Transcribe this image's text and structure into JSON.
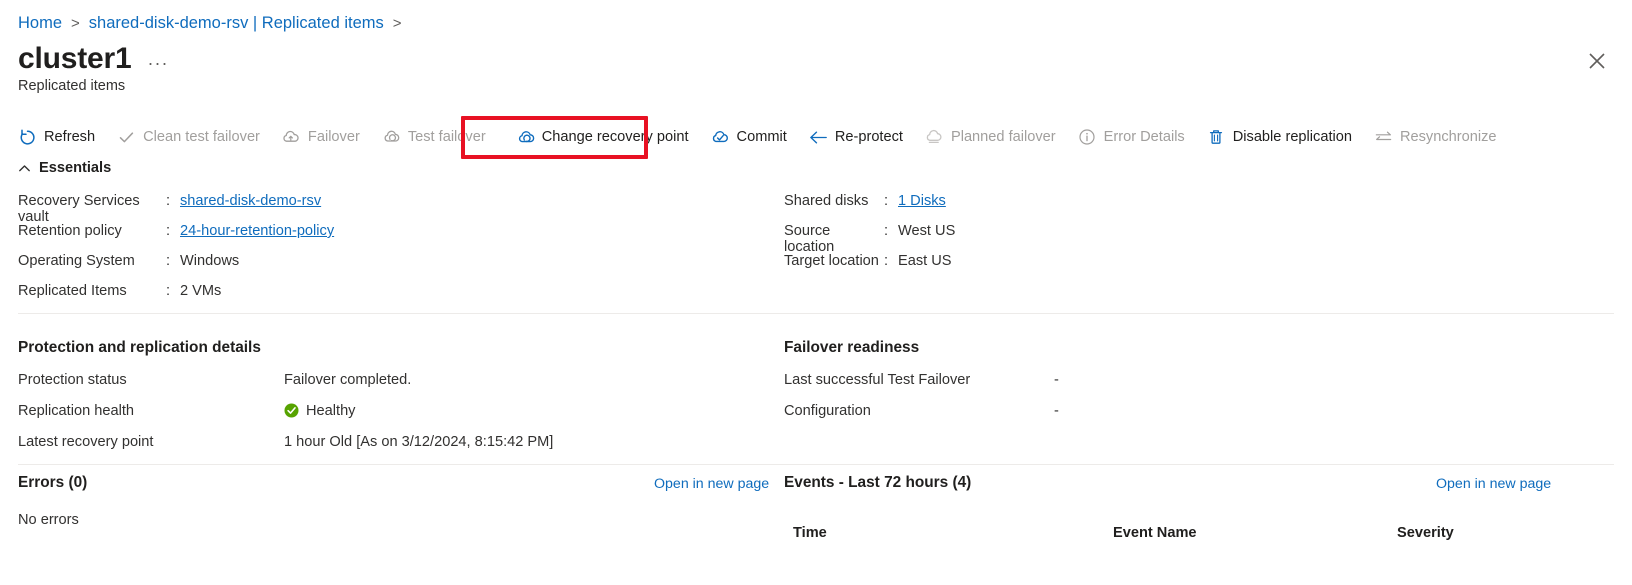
{
  "breadcrumb": {
    "items": [
      {
        "label": "Home",
        "link": true
      },
      {
        "label": "shared-disk-demo-rsv | Replicated items",
        "link": true
      }
    ],
    "separator": ">"
  },
  "header": {
    "title": "cluster1",
    "ellipsis": "···",
    "subtitle": "Replicated items",
    "close_icon": "close-icon"
  },
  "highlight": {
    "color": "#e81123",
    "target": "Change recovery point"
  },
  "commandbar": {
    "items": [
      {
        "label": "Refresh",
        "icon": "refresh-icon",
        "disabled": false,
        "highlighted": false
      },
      {
        "label": "Clean test failover",
        "icon": "checkmark-icon",
        "disabled": true,
        "highlighted": false
      },
      {
        "label": "Failover",
        "icon": "cloud-failover-icon",
        "disabled": true,
        "highlighted": false
      },
      {
        "label": "Test failover",
        "icon": "cloud-test-icon",
        "disabled": true,
        "highlighted": false
      },
      {
        "label": "Change recovery point",
        "icon": "cloud-recovery-icon",
        "disabled": false,
        "highlighted": true
      },
      {
        "label": "Commit",
        "icon": "cloud-check-icon",
        "disabled": false,
        "highlighted": false
      },
      {
        "label": "Re-protect",
        "icon": "arrow-left-icon",
        "disabled": false,
        "highlighted": false
      },
      {
        "label": "Planned failover",
        "icon": "cloud-planned-icon",
        "disabled": true,
        "highlighted": false
      },
      {
        "label": "Error Details",
        "icon": "info-circle-icon",
        "disabled": true,
        "highlighted": false
      },
      {
        "label": "Disable replication",
        "icon": "trash-icon",
        "disabled": false,
        "highlighted": false
      },
      {
        "label": "Resynchronize",
        "icon": "resync-arrows-icon",
        "disabled": true,
        "highlighted": false
      }
    ]
  },
  "essentials": {
    "heading": "Essentials",
    "collapse_icon": "chevron-up-icon",
    "left": [
      {
        "key": "Recovery Services vault",
        "colon": ":",
        "value": "shared-disk-demo-rsv",
        "link": true
      },
      {
        "key": "Retention policy",
        "colon": ":",
        "value": "24-hour-retention-policy",
        "link": true
      },
      {
        "key": "Operating System",
        "colon": ":",
        "value": "Windows",
        "link": false
      },
      {
        "key": "Replicated Items",
        "colon": ":",
        "value": "2 VMs",
        "link": false
      }
    ],
    "right": [
      {
        "key": "Shared disks",
        "colon": ":",
        "value": "1 Disks",
        "link": true
      },
      {
        "key": "Source location",
        "colon": ":",
        "value": "West US",
        "link": false
      },
      {
        "key": "Target location",
        "colon": ":",
        "value": "East US",
        "link": false
      }
    ]
  },
  "details": {
    "left_heading": "Protection and replication details",
    "right_heading": "Failover readiness",
    "left_rows": [
      {
        "key": "Protection status",
        "value": "Failover completed.",
        "icon": null
      },
      {
        "key": "Replication health",
        "value": "Healthy",
        "icon": "health-check-icon"
      },
      {
        "key": "Latest recovery point",
        "value": "1 hour Old [As on 3/12/2024, 8:15:42 PM]",
        "icon": null
      }
    ],
    "right_rows": [
      {
        "key": "Last successful Test Failover",
        "value": "-",
        "icon": null
      },
      {
        "key": "Configuration",
        "value": "-",
        "icon": null
      }
    ],
    "health_color": "#57a300"
  },
  "errors_panel": {
    "title": "Errors (0)",
    "open_link": "Open in new page",
    "empty_text": "No errors"
  },
  "events_panel": {
    "title": "Events - Last 72 hours (4)",
    "open_link": "Open in new page",
    "columns": [
      "Time",
      "Event Name",
      "Severity"
    ]
  },
  "colors": {
    "link": "#0f6cbd",
    "text": "#323130",
    "disabled": "#a19f9d",
    "divider": "#edebe9",
    "highlight": "#e81123"
  }
}
